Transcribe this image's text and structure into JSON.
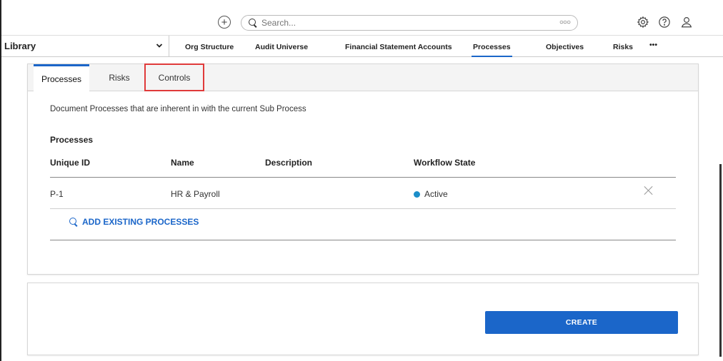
{
  "topbar": {
    "add_icon": "plus-circle-icon",
    "search": {
      "placeholder": "Search..."
    },
    "search_more_icon": "more-dots-icon",
    "settings_icon": "gear-icon",
    "help_icon": "help-circle-icon",
    "user_icon": "user-icon"
  },
  "nav": {
    "library_label": "Library",
    "items": [
      {
        "label": "Org Structure"
      },
      {
        "label": "Audit Universe"
      },
      {
        "label": "Financial Statement Accounts"
      },
      {
        "label": "Processes",
        "active": true
      },
      {
        "label": "Objectives"
      },
      {
        "label": "Risks"
      },
      {
        "label": "•••"
      }
    ]
  },
  "tabs": [
    {
      "label": "Processes",
      "active": true
    },
    {
      "label": "Risks"
    },
    {
      "label": "Controls",
      "highlighted": true
    }
  ],
  "content": {
    "description": "Document Processes that are inherent in with the current Sub Process",
    "section_title": "Processes",
    "columns": [
      "Unique ID",
      "Name",
      "Description",
      "Workflow State"
    ],
    "rows": [
      {
        "unique_id": "P-1",
        "name": "HR & Payroll",
        "description": "",
        "workflow_state": "Active",
        "state_color": "#1b8ec9"
      }
    ],
    "add_link": "ADD EXISTING PROCESSES"
  },
  "footer": {
    "create_label": "CREATE"
  },
  "colors": {
    "accent": "#1b66c9",
    "highlight": "#e03a3a",
    "active_state": "#1b8ec9"
  }
}
